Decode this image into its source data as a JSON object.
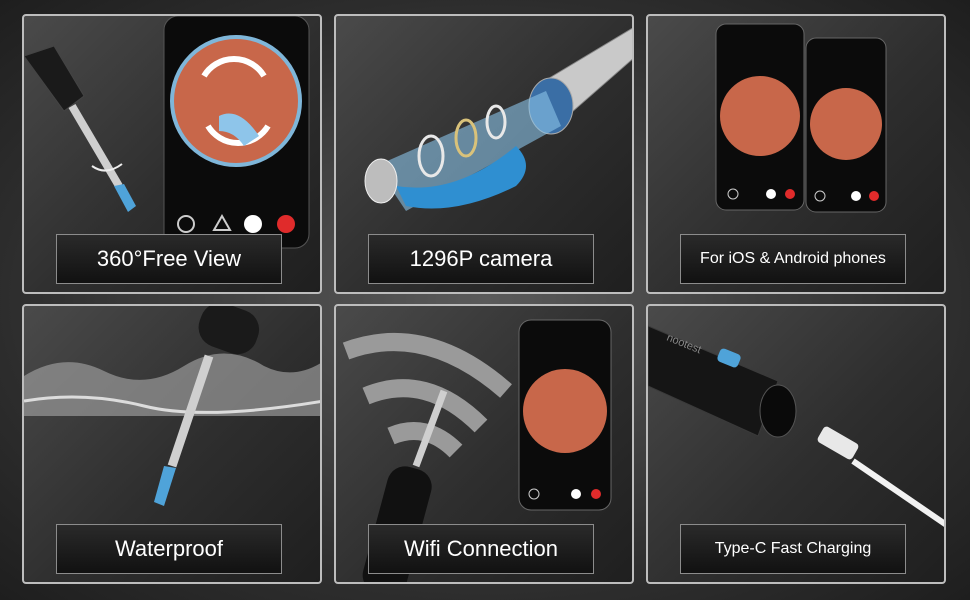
{
  "panels": [
    {
      "id": "free-view",
      "label": "360°Free View"
    },
    {
      "id": "camera",
      "label": "1296P camera"
    },
    {
      "id": "compat",
      "label": "For iOS & Android phones"
    },
    {
      "id": "waterproof",
      "label": "Waterproof"
    },
    {
      "id": "wifi",
      "label": "Wifi Connection"
    },
    {
      "id": "charging",
      "label": "Type-C Fast Charging"
    }
  ],
  "device_brand": "nootest",
  "icons": [
    "rotate-arrows-icon",
    "camera-lens-icon",
    "phone-icon",
    "water-splash-icon",
    "wifi-signal-icon",
    "usb-c-cable-icon",
    "shutter-icon",
    "record-icon"
  ],
  "colors": {
    "accent": "#4fa3d9",
    "record": "#e02b2b",
    "ear": "#c8674a",
    "panel_border": "#bdbdbd"
  }
}
